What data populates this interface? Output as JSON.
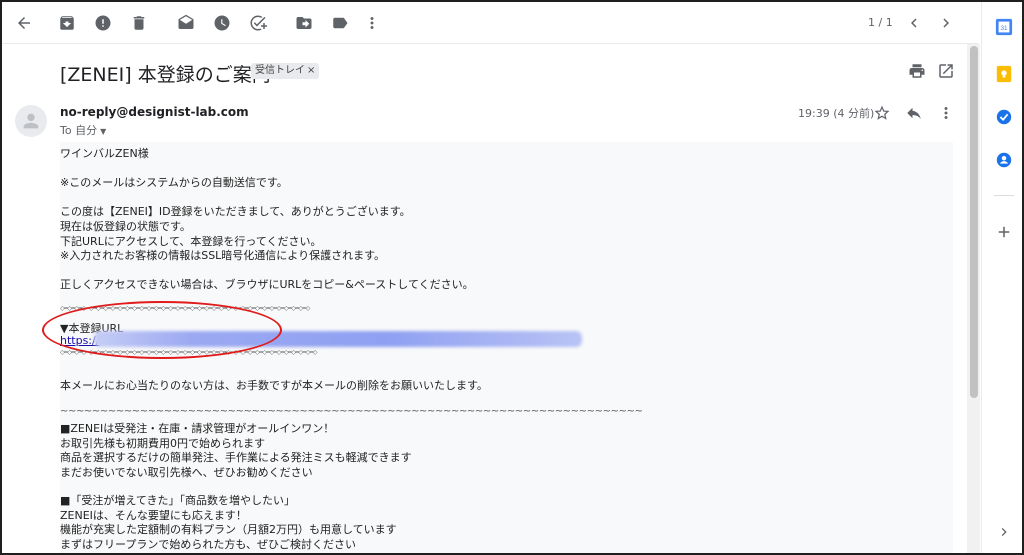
{
  "toolbar": {
    "page_count": "1 / 1",
    "icons": [
      "back-arrow-icon",
      "archive-icon",
      "report-spam-icon",
      "delete-icon",
      "mark-unread-icon",
      "snooze-icon",
      "add-task-icon",
      "move-to-icon",
      "label-icon",
      "more-vert-icon",
      "chevron-left-icon",
      "chevron-right-icon"
    ]
  },
  "email": {
    "subject": "[ZENEI] 本登録のご案内",
    "label": "受信トレイ",
    "label_close": "×",
    "sender": "no-reply@designist-lab.com",
    "recipient": "To 自分",
    "time": "19:39 (4 分前)"
  },
  "body": {
    "lines": [
      "ワインバルZEN様",
      "※このメールはシステムからの自動送信です。",
      "この度は【ZENEI】ID登録をいただきまして、ありがとうございます。",
      "現在は仮登録の状態です。",
      "下記URLにアクセスして、本登録を行ってください。",
      "※入力されたお客様の情報はSSL暗号化通信により保護されます。",
      "正しくアクセスできない場合は、ブラウザにURLをコピー&ペーストしてください。",
      "◇━◇━◇━◇━◇━◇━◇━◇━◇━◇━◇━◇━◇━◇━◇━◇━◇━◇━◇━◇━◇━◇━◇━◇━◇━◇━◇━◇━◇━◇━◇━◇━◇━◇━◇",
      "▼本登録URL",
      "https://",
      "◇━◇━◇━◇━◇━◇━◇━◇━◇━◇━◇━◇━◇━◇━◇━◇━◇━◇━◇━◇━◇━◇━◇━◇━◇━◇━◇━◇━◇━◇━◇━◇━◇━◇━◇━◇",
      "本メールにお心当たりのない方は、お手数ですが本メールの削除をお願いいたします。",
      "~~~~~~~~~~~~~~~~~~~~~~~~~~~~~~~~~~~~~~~~~~~~~~~~~~~~~~~~~~~~~~~~~~~~~~~~~",
      "■ZENEIは受発注・在庫・請求管理がオールインワン！",
      "お取引先様も初期費用0円で始められます",
      "商品を選択するだけの簡単発注、手作業による発注ミスも軽減できます",
      "まだお使いでない取引先様へ、ぜひお勧めください",
      "■「受注が増えてきた」「商品数を増やしたい」",
      "ZENEIは、そんな要望にも応えます！",
      "機能が充実した定額制の有料プラン（月額2万円）も用意しています",
      "まずはフリープランで始められた方も、ぜひご検討ください"
    ]
  },
  "colors": {
    "annotation": "#e11b1b",
    "link": "#1a0dab",
    "redaction": "#8fa0f2"
  },
  "rail": {
    "icons": [
      "calendar-icon",
      "keep-icon",
      "tasks-icon",
      "contacts-icon",
      "add-icon",
      "expand-icon"
    ]
  }
}
